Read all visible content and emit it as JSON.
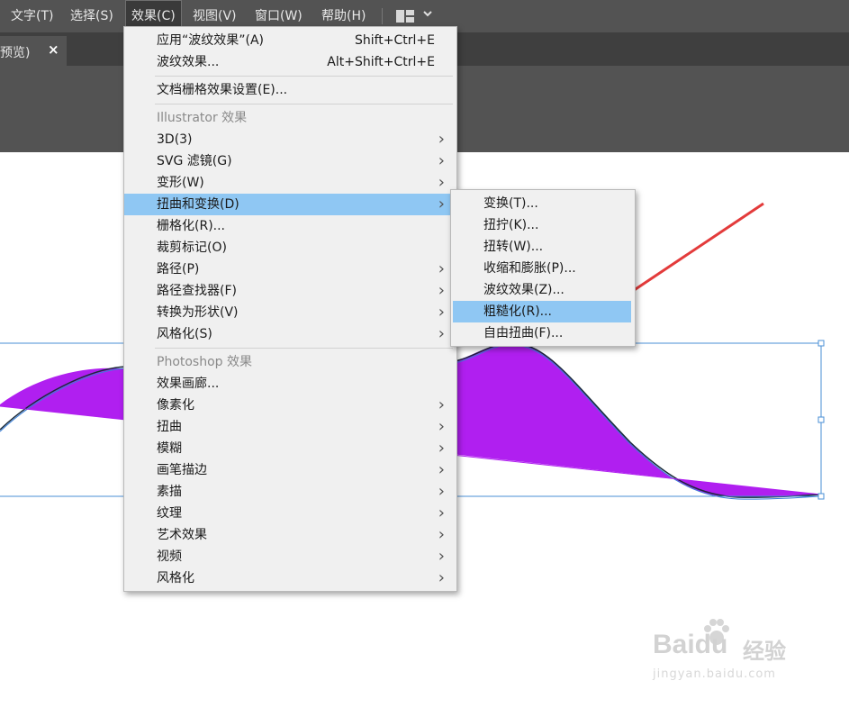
{
  "menubar": {
    "items": [
      "文字(T)",
      "选择(S)",
      "效果(C)",
      "视图(V)",
      "窗口(W)",
      "帮助(H)"
    ],
    "active_index": 2,
    "workspace_icon": "workspace-layout-icon",
    "chevron_icon": "chevron-down-icon"
  },
  "document_tab": {
    "label": "预览)",
    "close_glyph": "×"
  },
  "effect_menu": {
    "items": [
      {
        "label": "应用“波纹效果”(A)",
        "shortcut": "Shift+Ctrl+E"
      },
      {
        "label": "波纹效果...",
        "shortcut": "Alt+Shift+Ctrl+E"
      },
      {
        "separator": true
      },
      {
        "label": "文档栅格效果设置(E)..."
      },
      {
        "separator": true
      },
      {
        "label": "Illustrator 效果",
        "header": true
      },
      {
        "label": "3D(3)",
        "submenu": true
      },
      {
        "label": "SVG 滤镜(G)",
        "submenu": true
      },
      {
        "label": "变形(W)",
        "submenu": true
      },
      {
        "label": "扭曲和变换(D)",
        "submenu": true,
        "highlighted": true
      },
      {
        "label": "栅格化(R)..."
      },
      {
        "label": "裁剪标记(O)"
      },
      {
        "label": "路径(P)",
        "submenu": true
      },
      {
        "label": "路径查找器(F)",
        "submenu": true
      },
      {
        "label": "转换为形状(V)",
        "submenu": true
      },
      {
        "label": "风格化(S)",
        "submenu": true
      },
      {
        "separator": true
      },
      {
        "label": "Photoshop 效果",
        "header": true
      },
      {
        "label": "效果画廊..."
      },
      {
        "label": "像素化",
        "submenu": true
      },
      {
        "label": "扭曲",
        "submenu": true
      },
      {
        "label": "模糊",
        "submenu": true
      },
      {
        "label": "画笔描边",
        "submenu": true
      },
      {
        "label": "素描",
        "submenu": true
      },
      {
        "label": "纹理",
        "submenu": true
      },
      {
        "label": "艺术效果",
        "submenu": true
      },
      {
        "label": "视频",
        "submenu": true
      },
      {
        "label": "风格化",
        "submenu": true
      }
    ]
  },
  "distort_submenu": {
    "items": [
      {
        "label": "变换(T)..."
      },
      {
        "label": "扭拧(K)..."
      },
      {
        "label": "扭转(W)..."
      },
      {
        "label": "收缩和膨胀(P)..."
      },
      {
        "label": "波纹效果(Z)..."
      },
      {
        "label": "粗糙化(R)...",
        "highlighted": true
      },
      {
        "label": "自由扭曲(F)..."
      }
    ]
  },
  "artwork": {
    "fill_color": "#b01ff0",
    "selection_color": "#4a8fd6",
    "annotation_arrow_color": "#e33b3b"
  },
  "watermark": {
    "line1": "Baidu",
    "line2": "经验",
    "line3": "jingyan.baidu.com"
  },
  "colors": {
    "menubar_bg": "#535353",
    "menu_bg": "#f0f0f0",
    "highlight": "#8fc7f3"
  }
}
